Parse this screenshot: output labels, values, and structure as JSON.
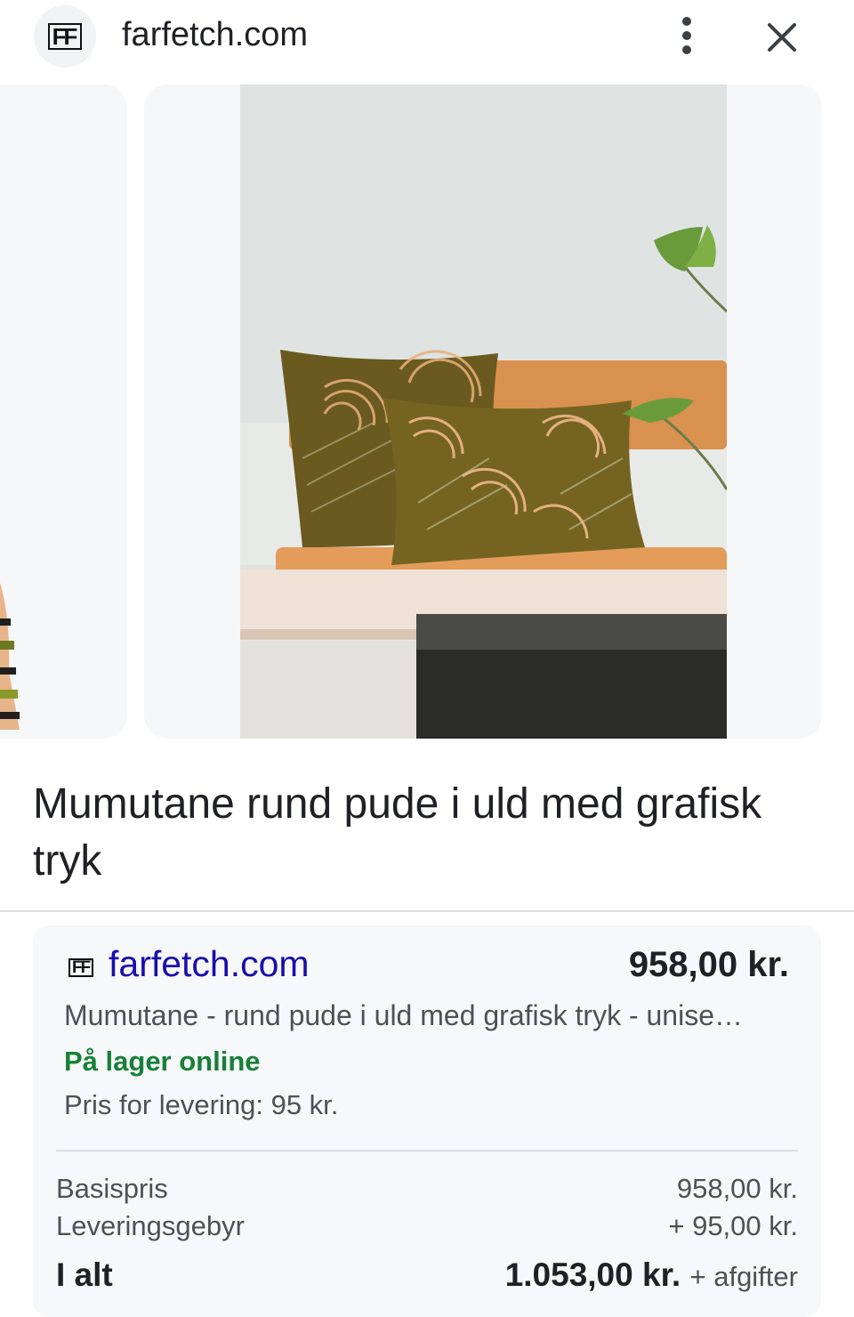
{
  "topbar": {
    "site_icon": "farfetch-logo-icon",
    "domain": "farfetch.com",
    "menu_icon": "more-vert-icon",
    "close_icon": "close-icon"
  },
  "product": {
    "title": "Mumutane rund pude i uld med grafisk tryk"
  },
  "offer": {
    "merchant": "farfetch.com",
    "price": "958,00 kr.",
    "description": "Mumutane - rund pude i uld med grafisk tryk - unise…",
    "stock": "På lager online",
    "delivery": "Pris for levering: 95 kr.",
    "breakdown": {
      "base_label": "Basispris",
      "base_value": "958,00 kr.",
      "fee_label": "Leveringsgebyr",
      "fee_value": "+ 95,00 kr.",
      "total_label": "I alt",
      "total_value": "1.053,00 kr.",
      "total_suffix": "+ afgifter"
    }
  },
  "colors": {
    "link": "#1a0dab",
    "stock": "#188038",
    "card_bg": "#f6f8f9"
  }
}
